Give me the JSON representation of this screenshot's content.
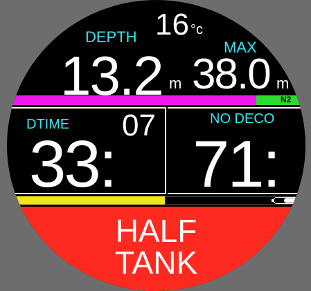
{
  "temperature": {
    "value": "16",
    "unit": "°c"
  },
  "depth": {
    "label": "DEPTH",
    "value": "13.2",
    "unit": "m"
  },
  "max_depth": {
    "label": "MAX",
    "value": "38.0",
    "unit": "m"
  },
  "gas": {
    "label": "N2"
  },
  "dive_time": {
    "label": "DTIME",
    "minutes": "33:",
    "seconds": "07"
  },
  "no_deco": {
    "label": "NO DECO",
    "value": "71:"
  },
  "alarm": {
    "line1": "HALF",
    "line2": "TANK"
  },
  "colors": {
    "cyan": "#36e6f0",
    "magenta_bar": "#ee18ee",
    "green_bar": "#2bdd2b",
    "yellow_bar": "#f2e51c",
    "alarm_red": "#ff2a1f"
  },
  "icons": {
    "battery": "battery-icon"
  }
}
